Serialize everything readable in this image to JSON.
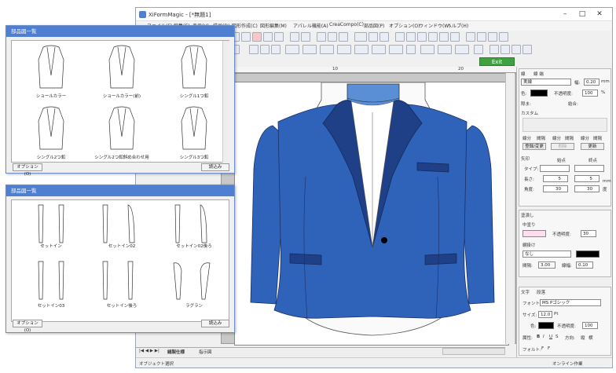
{
  "app": {
    "title": "XiFormMagic - [*無題1]",
    "status_left": "オブジェクト選択",
    "status_right": "オンライン作業",
    "exit": "Exit",
    "menus": [
      "ファイル(F)",
      "編集(E)",
      "表示(V)",
      "描画(D)",
      "図形作成(C)",
      "図形編集(M)",
      "アパレル機能(A)",
      "CreaCompo(C)",
      "部品図(P)",
      "オプション(O)",
      "ウィンドウ(W)",
      "ヘルプ(H)"
    ],
    "ruler_ticks": [
      "10",
      "20"
    ],
    "sheet_tabs": [
      "縫製仕様",
      "指示図"
    ]
  },
  "panel": {
    "line_tabs": [
      "線",
      "線 端"
    ],
    "line_style": "実線",
    "width_label": "幅:",
    "width_value": "0.20",
    "width_unit": "mm",
    "color_label": "色:",
    "opacity_label": "不透明度:",
    "opacity_value": "100",
    "pct": "%",
    "margin_label": "隙ま:",
    "join_label": "結合:",
    "custom_label": "カスタム",
    "dash_labels": [
      "線分",
      "間隔",
      "線分",
      "間隔",
      "線分",
      "間隔"
    ],
    "register": "登録/変更",
    "delete": "削除",
    "update": "更新",
    "arrow_label": "矢印",
    "start_label": "始点",
    "end_label": "終点",
    "type_label": "タイプ:",
    "length_label": "長さ:",
    "length_start": "5",
    "length_end": "5",
    "angle_label": "角度:",
    "angle_start": "30",
    "angle_end": "30",
    "mm": "mm",
    "deg": "度",
    "fill_tabs": [
      "塗潰し"
    ],
    "fill_label": "中塗り",
    "fill_opacity_label": "不透明度:",
    "fill_opacity_value": "30",
    "hatch_label": "網掛け",
    "hatch_value": "なし",
    "spacing_label": "間隔:",
    "spacing_value": "3.00",
    "linewidth_label": "線幅:",
    "linewidth_value": "0.10",
    "text_tabs": [
      "文字",
      "段落"
    ],
    "font_label": "フォント:",
    "font_value": "MS Pゴシック",
    "size_label": "サイズ:",
    "size_value": "12.0",
    "size_unit": "Pt",
    "text_color_label": "色:",
    "text_opacity_label": "不透明度:",
    "text_opacity_value": "100",
    "attr_label": "属性:",
    "attrs": [
      "B",
      "I",
      "U",
      "S"
    ],
    "dir_label": "方向:",
    "dirs": [
      "縦",
      "横"
    ],
    "effect_label": "フォルト:",
    "effects": [
      "F",
      "F"
    ]
  },
  "dialog1": {
    "title": "部品図一覧",
    "items": [
      "ショールカラー",
      "ショールカラー(前)",
      "シングル1つ釦",
      "シングル2つ釦",
      "シングル2つ釦斜め合わせ用",
      "シングル3つ釦"
    ],
    "option": "オプション(O)",
    "load": "読込み"
  },
  "dialog2": {
    "title": "部品図一覧",
    "items": [
      "セットイン",
      "セットイン02",
      "セットイン02後ろ",
      "セットイン03",
      "セットイン後ろ",
      "ラグラン"
    ],
    "option": "オプション(O)",
    "load": "読込み"
  },
  "colors": {
    "jacket": "#2f63b9",
    "lapel": "#1f3f86",
    "dress": "#5a8fd6",
    "exit": "#3fa13f",
    "title": "#4f7fd0"
  }
}
